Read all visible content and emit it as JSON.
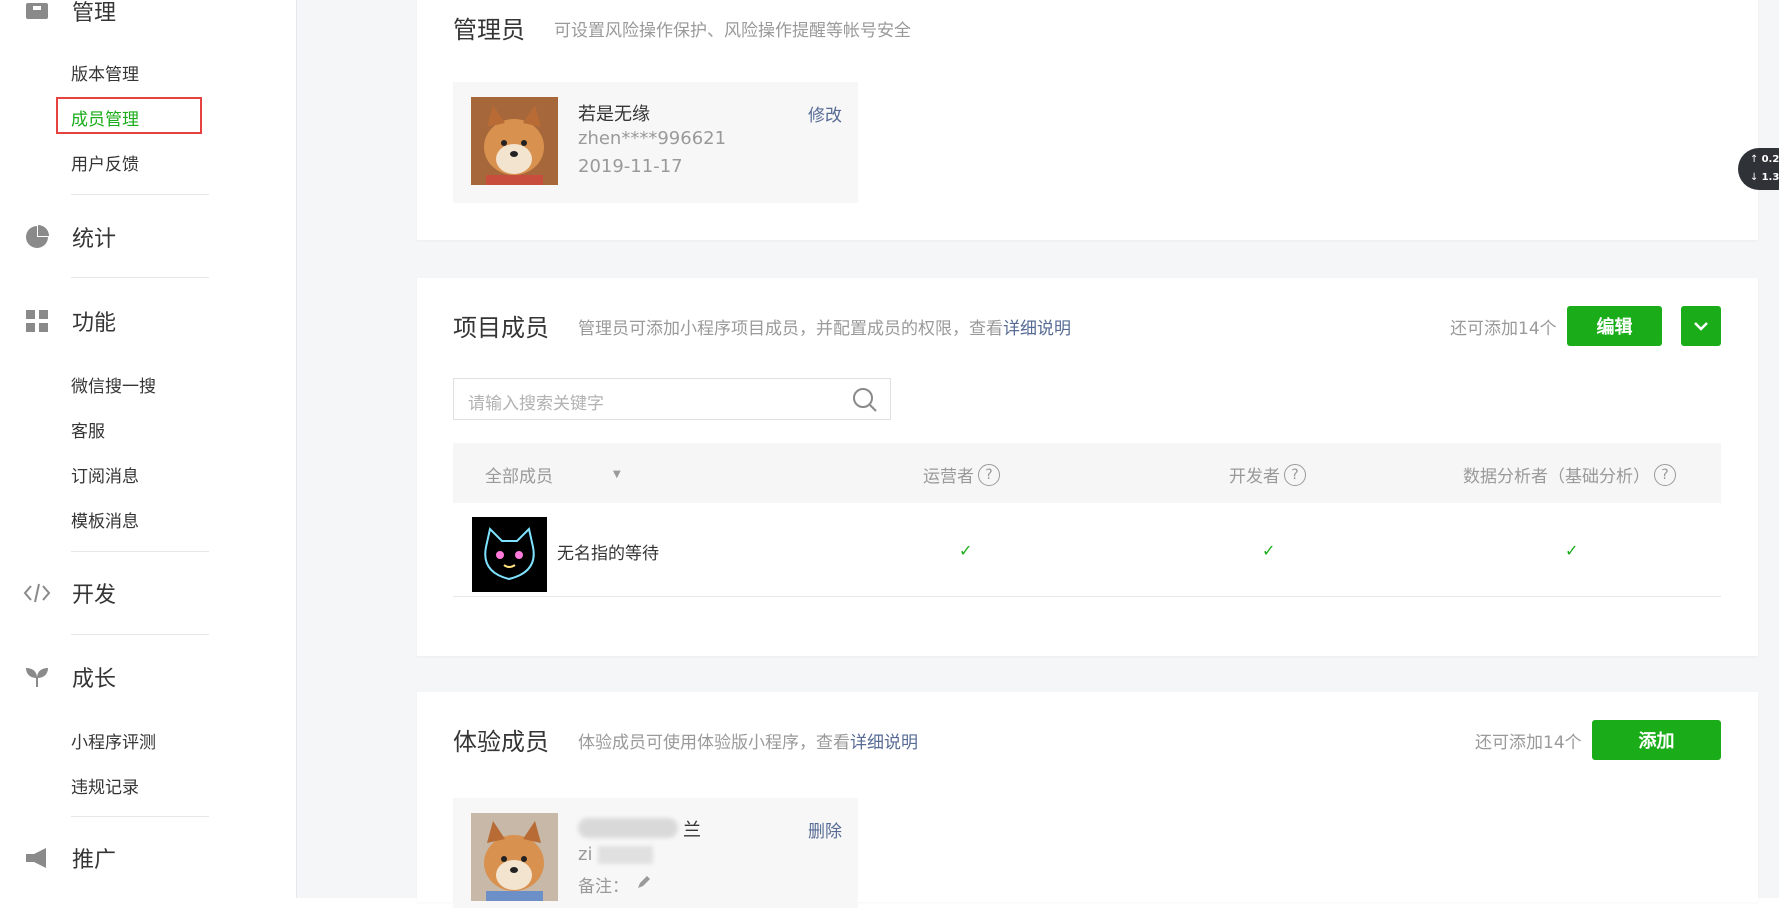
{
  "sidebar": {
    "guanli": {
      "title": "管理",
      "items": [
        "版本管理",
        "成员管理",
        "用户反馈"
      ]
    },
    "tongji": {
      "title": "统计"
    },
    "gongneng": {
      "title": "功能",
      "items": [
        "微信搜一搜",
        "客服",
        "订阅消息",
        "模板消息"
      ]
    },
    "kaifa": {
      "title": "开发"
    },
    "chengzhang": {
      "title": "成长",
      "items": [
        "小程序评测",
        "违规记录"
      ]
    },
    "tuiguang": {
      "title": "推广"
    }
  },
  "admin": {
    "title": "管理员",
    "desc": "可设置风险操作保护、风险操作提醒等帐号安全",
    "member": {
      "name": "若是无缘",
      "account": "zhen****996621",
      "date": "2019-11-17",
      "action": "修改"
    }
  },
  "project": {
    "title": "项目成员",
    "desc_prefix": "管理员可添加小程序项目成员，并配置成员的权限，查看",
    "desc_link": "详细说明",
    "remain": "还可添加14个",
    "edit_btn": "编辑",
    "search_placeholder": "请输入搜索关键字",
    "columns": {
      "all": "全部成员",
      "operator": "运营者",
      "developer": "开发者",
      "analyst": "数据分析者（基础分析）"
    },
    "rows": [
      {
        "name": "无名指的等待",
        "operator": "✓",
        "developer": "✓",
        "analyst": "✓"
      }
    ]
  },
  "trial": {
    "title": "体验成员",
    "desc_prefix": "体验成员可使用体验版小程序，查看",
    "desc_link": "详细说明",
    "remain": "还可添加14个",
    "add_btn": "添加",
    "member": {
      "name_end": "兰",
      "account_start": "zi",
      "note_label": "备注：",
      "action": "删除"
    }
  },
  "float": {
    "up": "0.2",
    "down": "1.3"
  },
  "colors": {
    "accent": "#1aad19",
    "link": "#576b95",
    "highlight": "#e64340"
  }
}
